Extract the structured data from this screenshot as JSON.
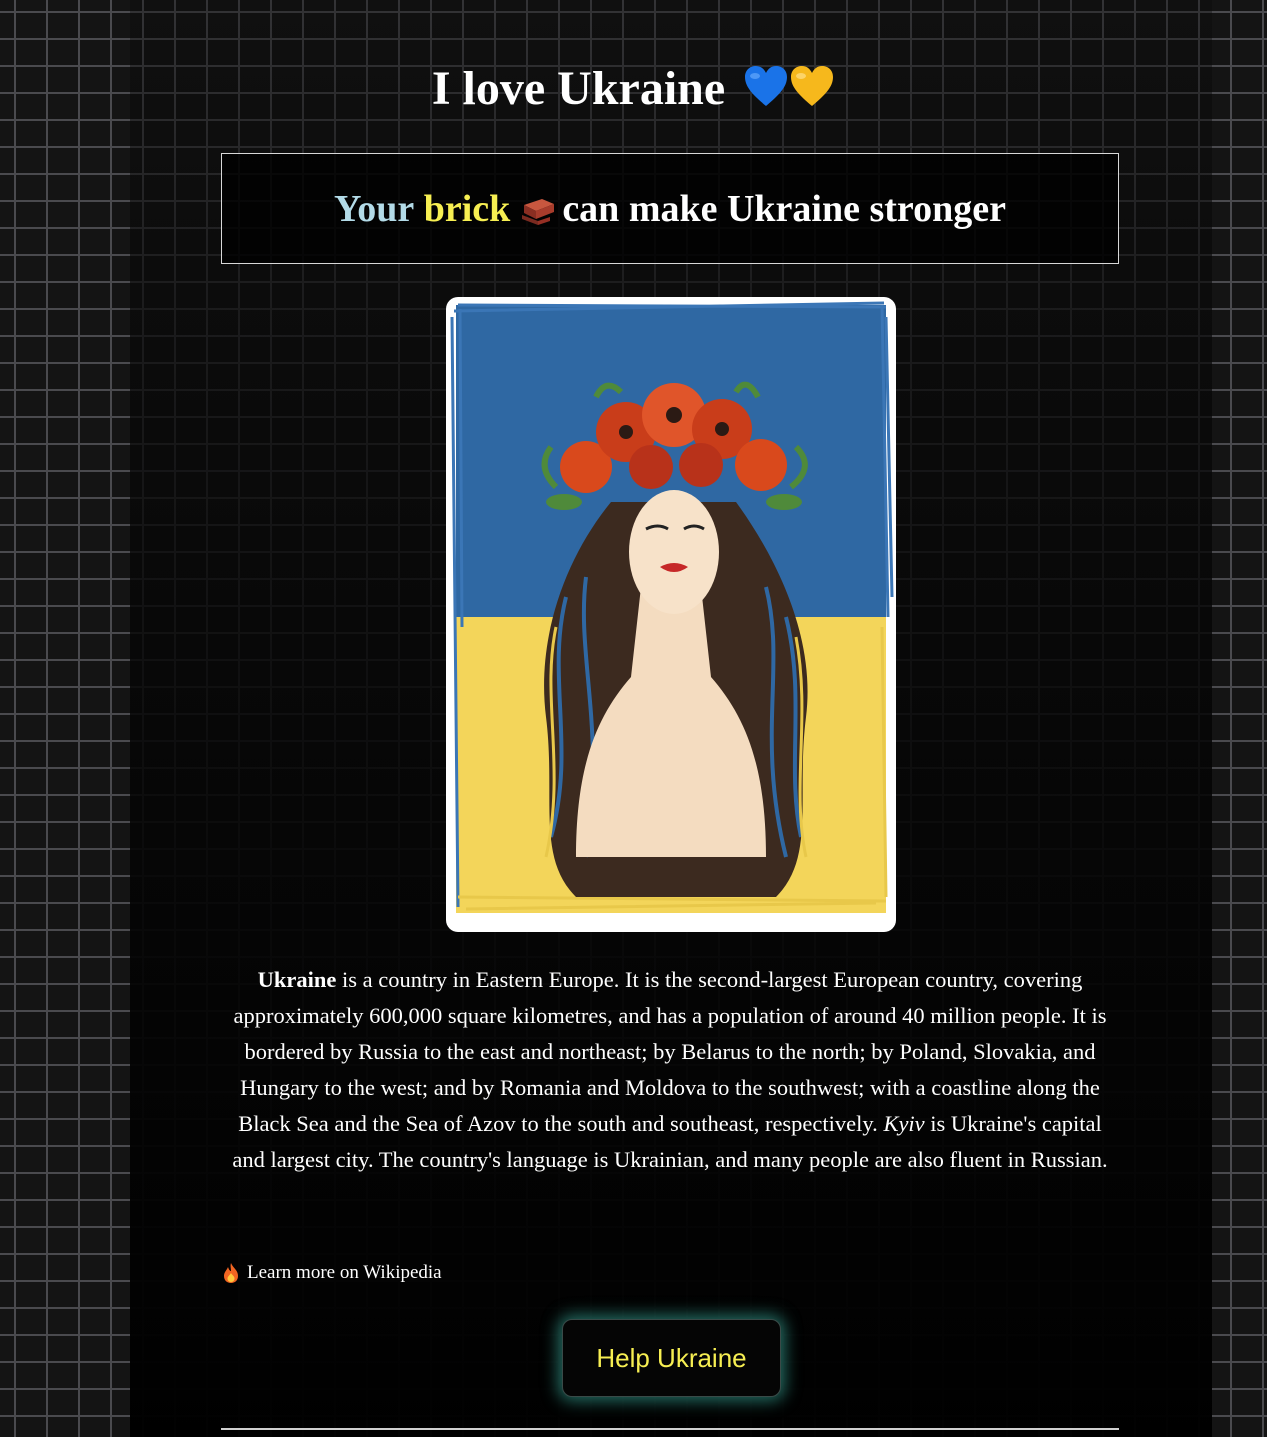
{
  "header": {
    "title": "I love Ukraine",
    "title_icons": [
      "blue-heart-icon",
      "yellow-heart-icon"
    ]
  },
  "banner": {
    "word_your": "Your",
    "word_brick": "brick",
    "brick_icon": "brick-icon",
    "rest": "can make Ukraine stronger"
  },
  "hero": {
    "image": "illustration of a woman with flower wreath on blue and yellow background"
  },
  "description": {
    "country": "Ukraine",
    "part1": " is a country in Eastern Europe. It is the second-largest European country, covering approximately 600,000 square kilometres, and has a population of around 40 million people. It is bordered by Russia to the east and northeast; by Belarus to the north; by Poland, Slovakia, and Hungary to the west; and by Romania and Moldova to the southwest; with a coastline along the Black Sea and the Sea of Azov to the south and southeast, respectively. ",
    "capital": "Kyiv",
    "part2": " is Ukraine's capital and largest city. The country's language is Ukrainian, and many people are also fluent in Russian."
  },
  "wiki_link": {
    "icon": "fire-icon",
    "label": "Learn more on Wikipedia"
  },
  "help_button": {
    "label": "Help Ukraine"
  },
  "colors": {
    "accent_yellow": "#f7ef52",
    "accent_light_blue": "#b3dbe8",
    "button_glow": "#40c4b2",
    "flag_blue": "#2f68a3",
    "flag_yellow": "#f3d55a"
  }
}
